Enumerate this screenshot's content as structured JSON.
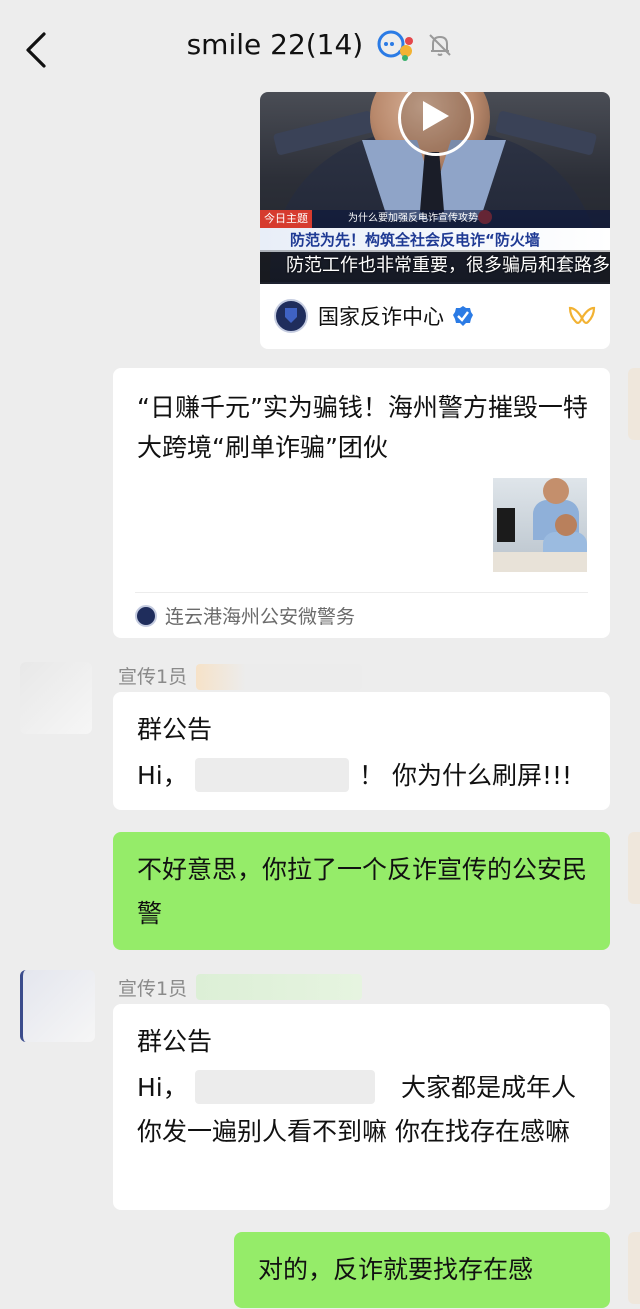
{
  "header": {
    "title": "smile 22(14)",
    "icons": [
      "back-icon",
      "chat-bubbles-icon",
      "mute-bell-icon"
    ]
  },
  "video_card": {
    "overlay_tag": "今日主题",
    "overlay_subtitle": "为什么要加强反电诈宣传攻势",
    "banner_main": "防范为先！构筑全社会反电诈“防火墙",
    "caption": "防范工作也非常重要，很多骗局和套路多…",
    "source": "国家反诈中心"
  },
  "article_card": {
    "title": "“日赚千元”实为骗钱！海州警方摧毁一特大跨境“刷单诈骗”团伙",
    "source": "连云港海州公安微警务"
  },
  "messages": [
    {
      "sender": "宣传1员",
      "notice_title": "群公告",
      "text_before": "Hi，",
      "text_after": "！ 你为什么刷屏!!!"
    },
    {
      "self_text": "不好意思，你拉了一个反诈宣传的公安民警"
    },
    {
      "sender": "宣传1员",
      "notice_title": "群公告",
      "text_before": "Hi，",
      "text_after": "大家都是成年人 你发一遍别人看不到嘛 你在找存在感嘛"
    },
    {
      "self_text": "对的，反诈就要找存在感"
    }
  ],
  "colors": {
    "background": "#ededed",
    "self_bubble": "#95ec69",
    "verified": "#2b7be5"
  }
}
